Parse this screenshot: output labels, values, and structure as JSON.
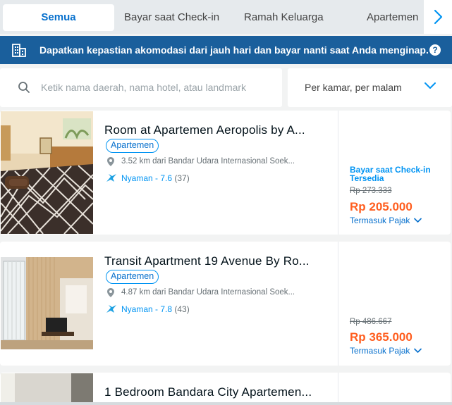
{
  "tabs": [
    {
      "label": "Semua",
      "active": true
    },
    {
      "label": "Bayar saat Check-in"
    },
    {
      "label": "Ramah Keluarga"
    },
    {
      "label": "Apartemen"
    }
  ],
  "banner": {
    "text": "Dapatkan kepastian akomodasi dari jauh hari dan bayar nanti saat Anda menginap.",
    "help": "?"
  },
  "search": {
    "placeholder": "Ketik nama daerah, nama hotel, atau landmark"
  },
  "price_filter": {
    "label": "Per kamar, per malam"
  },
  "listings": [
    {
      "title": "Room at Apartemen Aeropolis by A...",
      "type": "Apartemen",
      "location": "3.52 km dari Bandar Udara Internasional Soek...",
      "rating": "Nyaman - 7.6",
      "reviews": "(37)",
      "pay_note": "Bayar saat Check-in Tersedia",
      "old_price": "Rp 273.333",
      "price": "Rp 205.000",
      "tax": "Termasuk Pajak"
    },
    {
      "title": "Transit Apartment 19 Avenue By Ro...",
      "type": "Apartemen",
      "location": "4.87 km dari Bandar Udara Internasional Soek...",
      "rating": "Nyaman - 7.8",
      "reviews": "(43)",
      "old_price": "Rp 486.667",
      "price": "Rp 365.000",
      "tax": "Termasuk Pajak"
    },
    {
      "title": "1 Bedroom Bandara City Apartemen..."
    }
  ],
  "colors": {
    "accent": "#0194f3",
    "link": "#0770cd",
    "price": "#ff5e1f",
    "banner": "#1a5f9c"
  }
}
